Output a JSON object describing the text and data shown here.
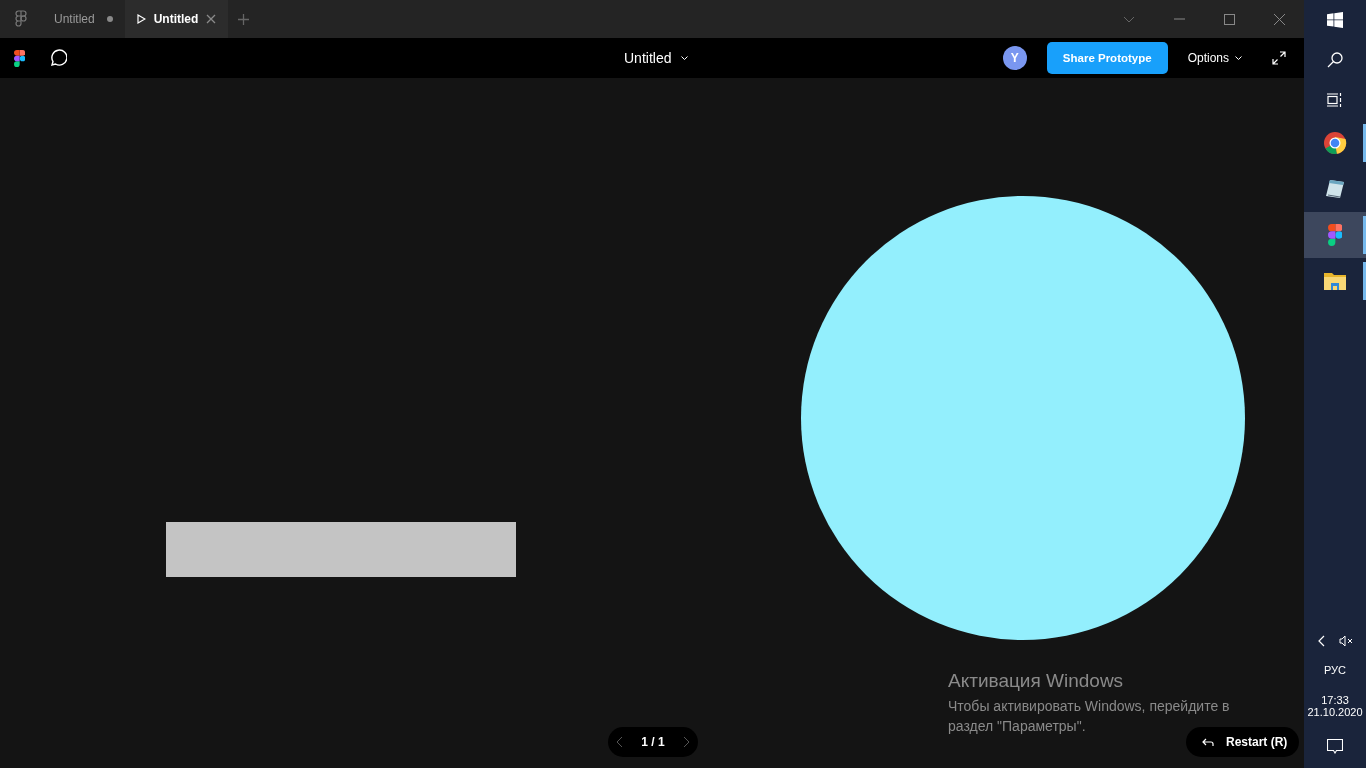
{
  "tabs": [
    {
      "label": "Untitled",
      "kind": "file",
      "selected": false,
      "unsaved": true
    },
    {
      "label": "Untitled",
      "kind": "prototype",
      "selected": true,
      "unsaved": false
    }
  ],
  "toolbar": {
    "title": "Untitled",
    "avatar": "Y",
    "share_button": "Share Prototype",
    "options": "Options"
  },
  "canvas": {
    "shapes": [
      {
        "kind": "rectangle",
        "color": "#c4c4c4"
      },
      {
        "kind": "circle",
        "color": "#93effd"
      }
    ]
  },
  "pager": {
    "label": "1 / 1"
  },
  "restart_button": "Restart (R)",
  "activation_notice": {
    "title": "Активация Windows",
    "text": "Чтобы активировать Windows, перейдите в раздел \"Параметры\"."
  },
  "taskbar": {
    "apps": [
      {
        "kind": "browser",
        "running": true,
        "selected": false
      },
      {
        "kind": "notepad",
        "running": false,
        "selected": false
      },
      {
        "kind": "figma",
        "running": true,
        "selected": true
      },
      {
        "kind": "explorer",
        "running": true,
        "selected": false
      }
    ],
    "language": "РУС",
    "time": "17:33",
    "date": "21.10.2020"
  }
}
